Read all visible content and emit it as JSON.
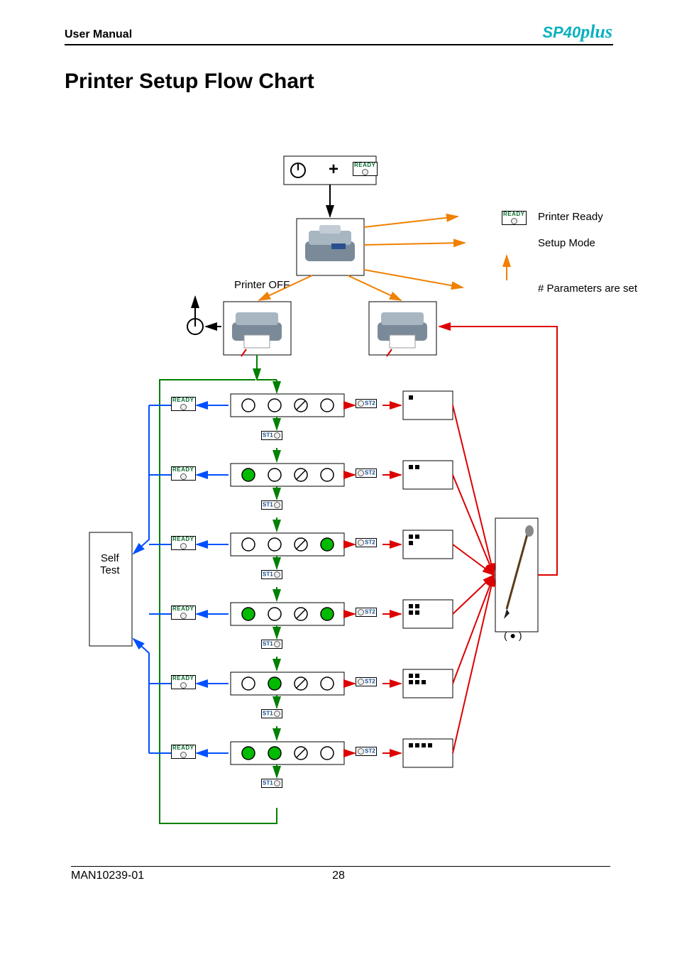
{
  "header": {
    "left": "User Manual",
    "product": "SP40",
    "product_suffix": "plus"
  },
  "title": "Printer Setup Flow Chart",
  "footer": {
    "doc": "MAN10239-01",
    "page": "28"
  },
  "labels": {
    "printer_ready": "Printer Ready",
    "setup_mode": "Setup Mode",
    "printer_off": "Printer OFF",
    "params_set": "# Parameters are set",
    "self_test_1": "Self",
    "self_test_2": "Test",
    "ready": "READY",
    "st1": "ST1",
    "st2": "ST2",
    "plus": "+",
    "pen_caption": "( ● )"
  },
  "diagram": {
    "led_rows": [
      {
        "leds": [
          0,
          0,
          0,
          0
        ]
      },
      {
        "leds": [
          1,
          0,
          0,
          0
        ]
      },
      {
        "leds": [
          0,
          0,
          0,
          1
        ]
      },
      {
        "leds": [
          1,
          0,
          0,
          1
        ]
      },
      {
        "leds": [
          0,
          1,
          0,
          0
        ]
      },
      {
        "leds": [
          1,
          1,
          0,
          0
        ]
      }
    ],
    "dot_patterns": [
      [
        [
          1
        ]
      ],
      [
        [
          1,
          1
        ]
      ],
      [
        [
          1,
          1
        ],
        [
          1,
          0
        ]
      ],
      [
        [
          1,
          1
        ],
        [
          1,
          1
        ]
      ],
      [
        [
          1,
          1,
          0
        ],
        [
          1,
          1,
          1
        ]
      ],
      [
        [
          1,
          1,
          1,
          1
        ]
      ]
    ]
  }
}
